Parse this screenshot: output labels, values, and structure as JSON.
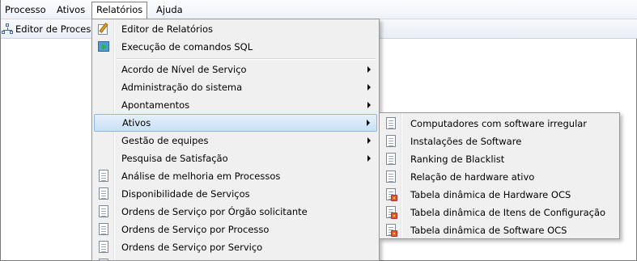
{
  "menubar": {
    "items": [
      {
        "label": "Processo"
      },
      {
        "label": "Ativos"
      },
      {
        "label": "Relatórios"
      },
      {
        "label": "Ajuda"
      }
    ]
  },
  "toolbar": {
    "editor_label": "Editor de Processo"
  },
  "dropdown": {
    "items": [
      {
        "label": "Editor de Relatórios",
        "icon": "report-edit-icon"
      },
      {
        "label": "Execução de comandos SQL",
        "icon": "sql-run-icon"
      },
      {
        "label": "Acordo de Nível de Serviço",
        "submenu": true
      },
      {
        "label": "Administração do sistema",
        "submenu": true
      },
      {
        "label": "Apontamentos",
        "submenu": true
      },
      {
        "label": "Ativos",
        "submenu": true,
        "highlighted": true
      },
      {
        "label": "Gestão de equipes",
        "submenu": true
      },
      {
        "label": "Pesquisa de Satisfação",
        "submenu": true
      },
      {
        "label": "Análise de melhoria em Processos",
        "icon": "document-icon"
      },
      {
        "label": "Disponibilidade de Serviços",
        "icon": "document-icon"
      },
      {
        "label": "Ordens de Serviço por Órgão solicitante",
        "icon": "document-icon"
      },
      {
        "label": "Ordens de Serviço por Processo",
        "icon": "document-icon"
      },
      {
        "label": "Ordens de Serviço por Serviço",
        "icon": "document-icon"
      }
    ]
  },
  "submenu_ativos": {
    "items": [
      {
        "label": "Computadores com software irregular",
        "icon": "document-icon"
      },
      {
        "label": "Instalações de Software",
        "icon": "document-icon"
      },
      {
        "label": "Ranking de Blacklist",
        "icon": "document-icon"
      },
      {
        "label": "Relação de hardware ativo",
        "icon": "document-icon"
      },
      {
        "label": "Tabela dinâmica de Hardware OCS",
        "icon": "pivot-document-icon"
      },
      {
        "label": "Tabela dinâmica de Itens de Configuração",
        "icon": "pivot-document-icon"
      },
      {
        "label": "Tabela dinâmica de Software OCS",
        "icon": "pivot-document-icon"
      }
    ]
  },
  "colors": {
    "highlight": "#c9e0f7",
    "menu_bg": "#f0f0f0"
  }
}
